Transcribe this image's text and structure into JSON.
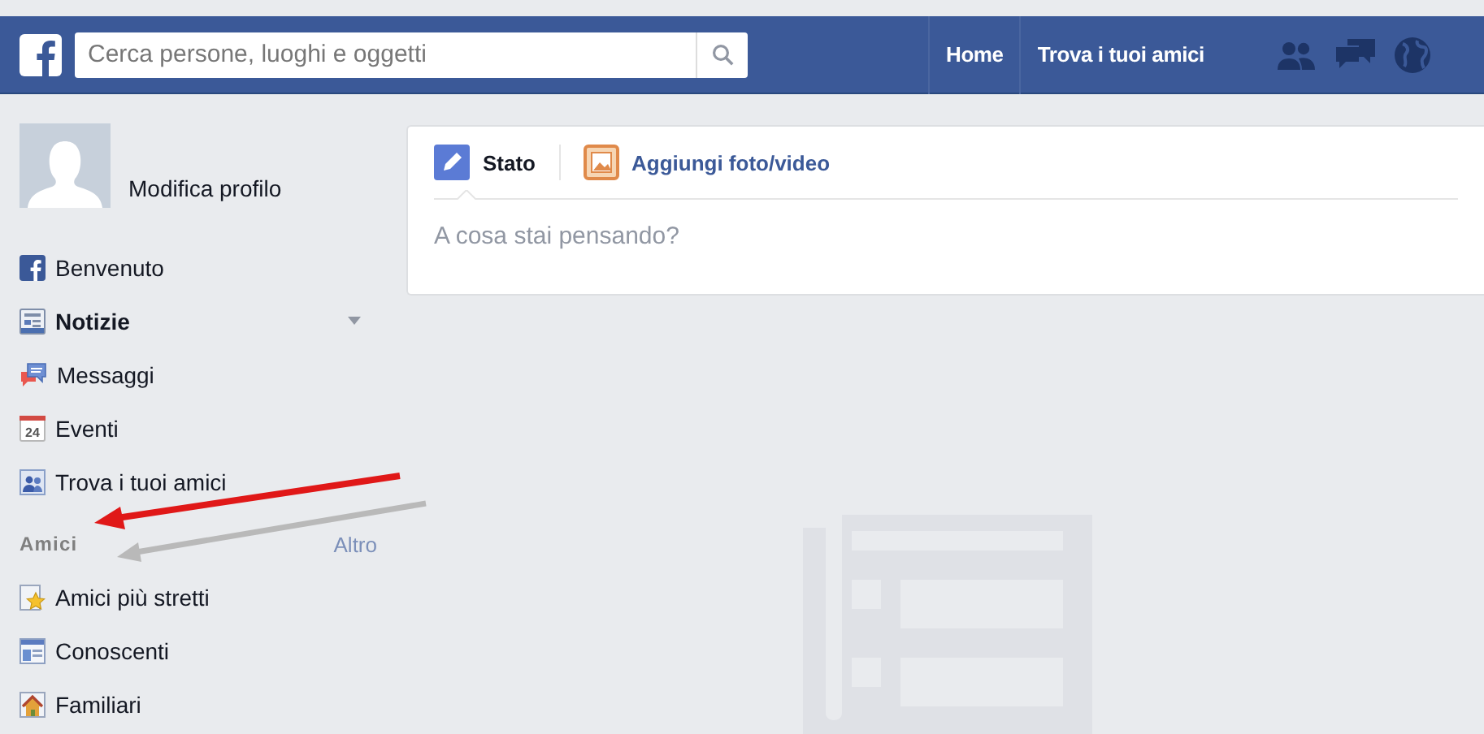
{
  "top_bar": {
    "search": {
      "placeholder": "Cerca persone, luoghi e oggetti"
    },
    "nav_links": [
      "Home",
      "Trova i tuoi amici"
    ]
  },
  "sidebar": {
    "profile_link": "Modifica profilo",
    "items": [
      {
        "label": "Benvenuto",
        "selected": false
      },
      {
        "label": "Notizie",
        "selected": true
      },
      {
        "label": "Messaggi",
        "selected": false
      },
      {
        "label": "Eventi",
        "selected": false,
        "calendar_day": "24"
      },
      {
        "label": "Trova i tuoi amici",
        "selected": false
      }
    ],
    "section": {
      "title": "Amici",
      "more_link": "Altro",
      "items": [
        {
          "label": "Amici più stretti"
        },
        {
          "label": "Conoscenti"
        },
        {
          "label": "Familiari"
        }
      ]
    }
  },
  "composer": {
    "tabs": [
      {
        "label": "Stato",
        "selected": true
      },
      {
        "label": "Aggiungi foto/video",
        "selected": false
      }
    ],
    "placeholder": "A cosa stai pensando?"
  }
}
